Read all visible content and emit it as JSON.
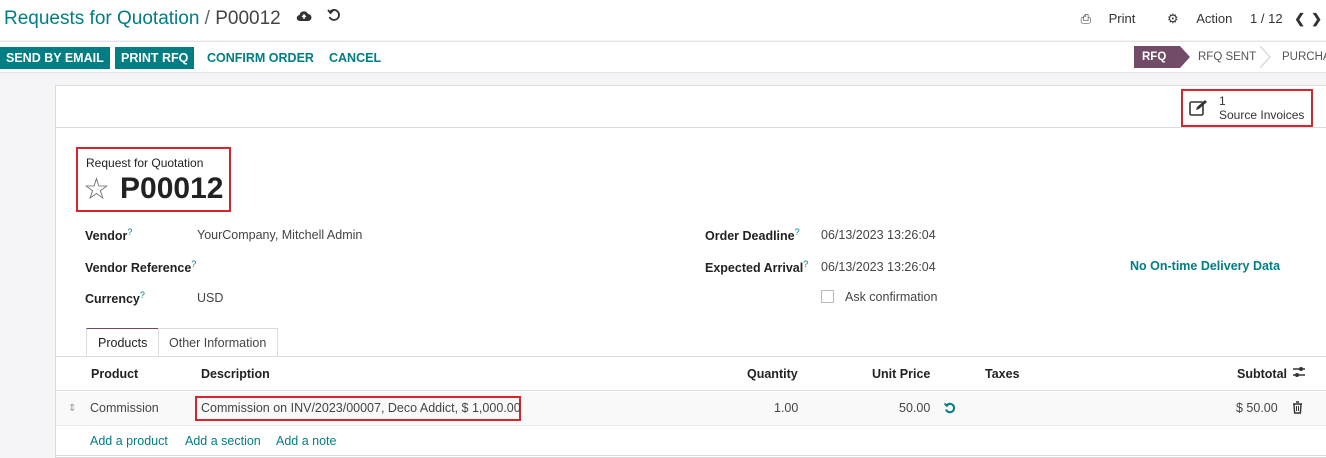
{
  "breadcrumb": {
    "parent": "Requests for Quotation",
    "separator": "/",
    "current": "P00012"
  },
  "top_actions": {
    "print": "Print",
    "action": "Action",
    "pager": "1 / 12"
  },
  "buttons": {
    "send_email": "SEND BY EMAIL",
    "print_rfq": "PRINT RFQ",
    "confirm": "CONFIRM ORDER",
    "cancel": "CANCEL"
  },
  "statusbar": {
    "rfq": "RFQ",
    "rfq_sent": "RFQ SENT",
    "purchase": "PURCHA"
  },
  "smart_button": {
    "count": "1",
    "label": "Source Invoices"
  },
  "title": {
    "small": "Request for Quotation",
    "name": "P00012"
  },
  "fields": {
    "vendor_label": "Vendor",
    "vendor_value": "YourCompany, Mitchell Admin",
    "vendor_ref_label": "Vendor Reference",
    "currency_label": "Currency",
    "currency_value": "USD",
    "deadline_label": "Order Deadline",
    "deadline_value": "06/13/2023 13:26:04",
    "arrival_label": "Expected Arrival",
    "arrival_value": "06/13/2023 13:26:04",
    "ask_confirmation": "Ask confirmation",
    "delivery_data": "No On-time Delivery Data",
    "help_mark": "?"
  },
  "tabs": [
    "Products",
    "Other Information"
  ],
  "table": {
    "headers": [
      "Product",
      "Description",
      "Quantity",
      "Unit Price",
      "Taxes",
      "Subtotal"
    ],
    "rows": [
      {
        "product": "Commission",
        "description": "Commission on INV/2023/00007, Deco Addict, $ 1,000.00",
        "quantity": "1.00",
        "unit_price": "50.00",
        "taxes": "",
        "subtotal": "$ 50.00"
      }
    ],
    "add_links": [
      "Add a product",
      "Add a section",
      "Add a note"
    ]
  },
  "colors": {
    "accent": "#017e84",
    "brand": "#714b67",
    "highlight": "#d9232d"
  }
}
